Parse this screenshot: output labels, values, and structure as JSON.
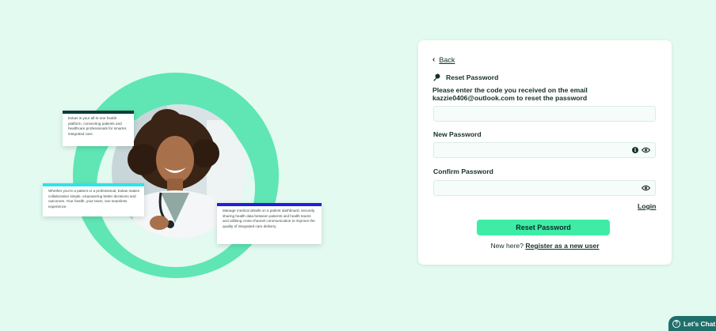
{
  "hero": {
    "card_1": "Exkas is your all-in-one health platform, connecting patients and healthcare professionals for smarter, integrated care.",
    "card_2": "Whether you're a patient or a professional, Exkas makes collaboration simple, empowering better decisions and outcomes. Your health, your team, one seamless experience.",
    "card_3": "Manage medical details on a patient dashboard, securely sharing health data between patients and health teams and utilising cross-channel communication to improve the quality of integrated care delivery.",
    "colors": {
      "card_1_bar": "#0f3b38",
      "card_2_bar": "#2ee3ea",
      "card_3_bar": "#1f20d6",
      "ring": "#5fe6b4"
    }
  },
  "form": {
    "back_label": "Back",
    "title": "Reset Password",
    "instructions_line1": "Please enter the code you received on the email",
    "instructions_line2": "kazzie0406@outlook.com to reset the password",
    "code": {
      "value": "",
      "placeholder": ""
    },
    "new_password": {
      "label": "New Password",
      "value": ""
    },
    "confirm_password": {
      "label": "Confirm Password",
      "value": ""
    },
    "info_icon_glyph": "i",
    "login_link": "Login",
    "submit_label": "Reset Password",
    "register_prompt": "New here?",
    "register_link": "Register as a new user",
    "accent_color": "#3eeca6"
  },
  "chat": {
    "label": "Let's Chat",
    "glyph": "?"
  }
}
